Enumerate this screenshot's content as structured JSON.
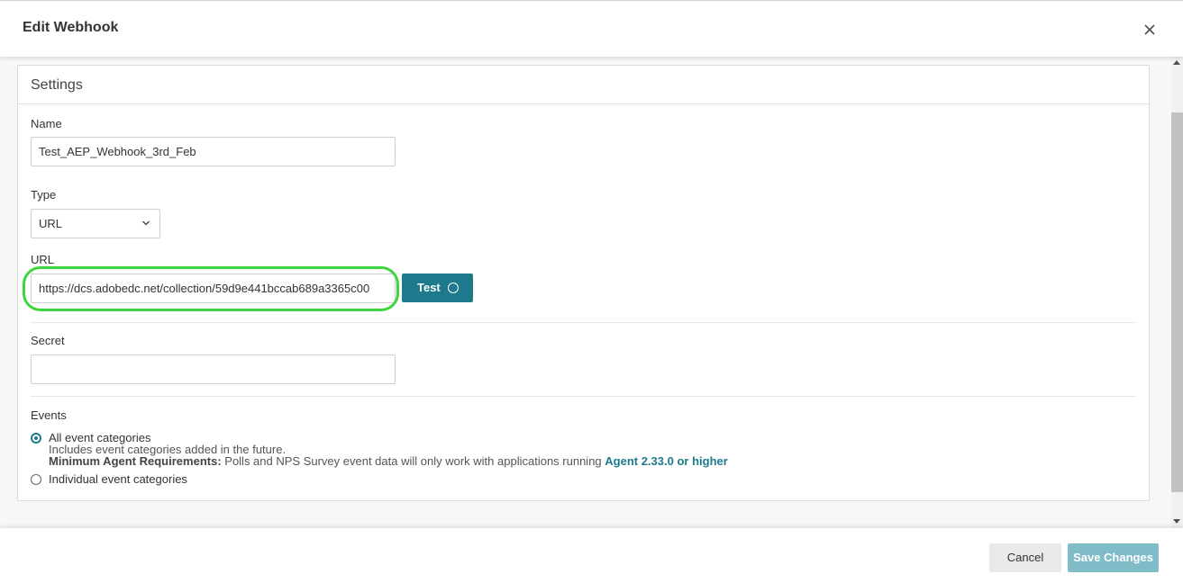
{
  "header": {
    "title": "Edit Webhook",
    "close_icon": "close-icon"
  },
  "settings": {
    "title": "Settings",
    "name": {
      "label": "Name",
      "value": "Test_AEP_Webhook_3rd_Feb"
    },
    "type": {
      "label": "Type",
      "value": "URL"
    },
    "url": {
      "label": "URL",
      "value": "https://dcs.adobedc.net/collection/59d9e441bccab689a3365c00",
      "test_label": "Test"
    },
    "secret": {
      "label": "Secret",
      "value": ""
    },
    "events": {
      "label": "Events",
      "options": [
        {
          "label": "All event categories",
          "selected": true,
          "description": "Includes event categories added in the future.",
          "requirement_label": "Minimum Agent Requirements:",
          "requirement_text": " Polls and NPS Survey event data will only work with applications running ",
          "requirement_link": "Agent 2.33.0 or higher"
        },
        {
          "label": "Individual event categories",
          "selected": false
        }
      ]
    }
  },
  "footer": {
    "cancel_label": "Cancel",
    "save_label": "Save Changes"
  },
  "colors": {
    "accent": "#1d7a8c",
    "highlight": "#3ed63e",
    "save_disabled": "#7fbcc7"
  }
}
